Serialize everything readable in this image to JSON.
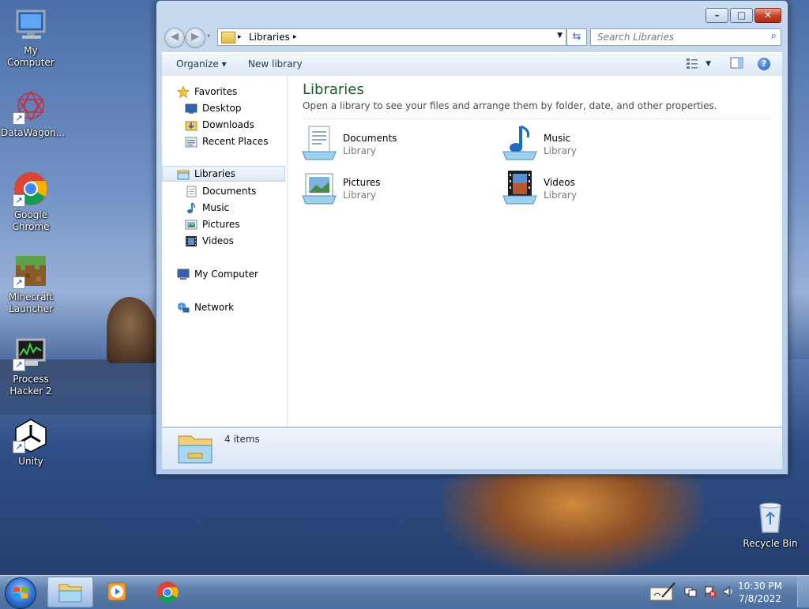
{
  "desktop": {
    "icons": [
      {
        "label": "My Computer"
      },
      {
        "label": "DataWagon..."
      },
      {
        "label": "Google Chrome"
      },
      {
        "label": "Minecraft Launcher"
      },
      {
        "label": "Process Hacker 2"
      },
      {
        "label": "Unity"
      },
      {
        "label": "Recycle Bin"
      }
    ]
  },
  "window": {
    "title_buttons": {
      "minimize": "–",
      "maximize": "□",
      "close": "✕"
    },
    "address": {
      "crumb": "Libraries",
      "arrow": "▸"
    },
    "search": {
      "placeholder": "Search Libraries"
    },
    "toolbar": {
      "organize": "Organize ▾",
      "new_library": "New library",
      "help": "?"
    },
    "nav": {
      "favorites": "Favorites",
      "favorites_items": [
        "Desktop",
        "Downloads",
        "Recent Places"
      ],
      "libraries": "Libraries",
      "libraries_items": [
        "Documents",
        "Music",
        "Pictures",
        "Videos"
      ],
      "computer": "My Computer",
      "network": "Network"
    },
    "main": {
      "title": "Libraries",
      "subtitle": "Open a library to see your files and arrange them by folder, date, and other properties.",
      "libraries": [
        {
          "name": "Documents",
          "kind": "Library"
        },
        {
          "name": "Music",
          "kind": "Library"
        },
        {
          "name": "Pictures",
          "kind": "Library"
        },
        {
          "name": "Videos",
          "kind": "Library"
        }
      ]
    },
    "details": {
      "count": "4 items"
    }
  },
  "taskbar": {
    "clock_time": "10:30 PM",
    "clock_date": "7/8/2022"
  }
}
